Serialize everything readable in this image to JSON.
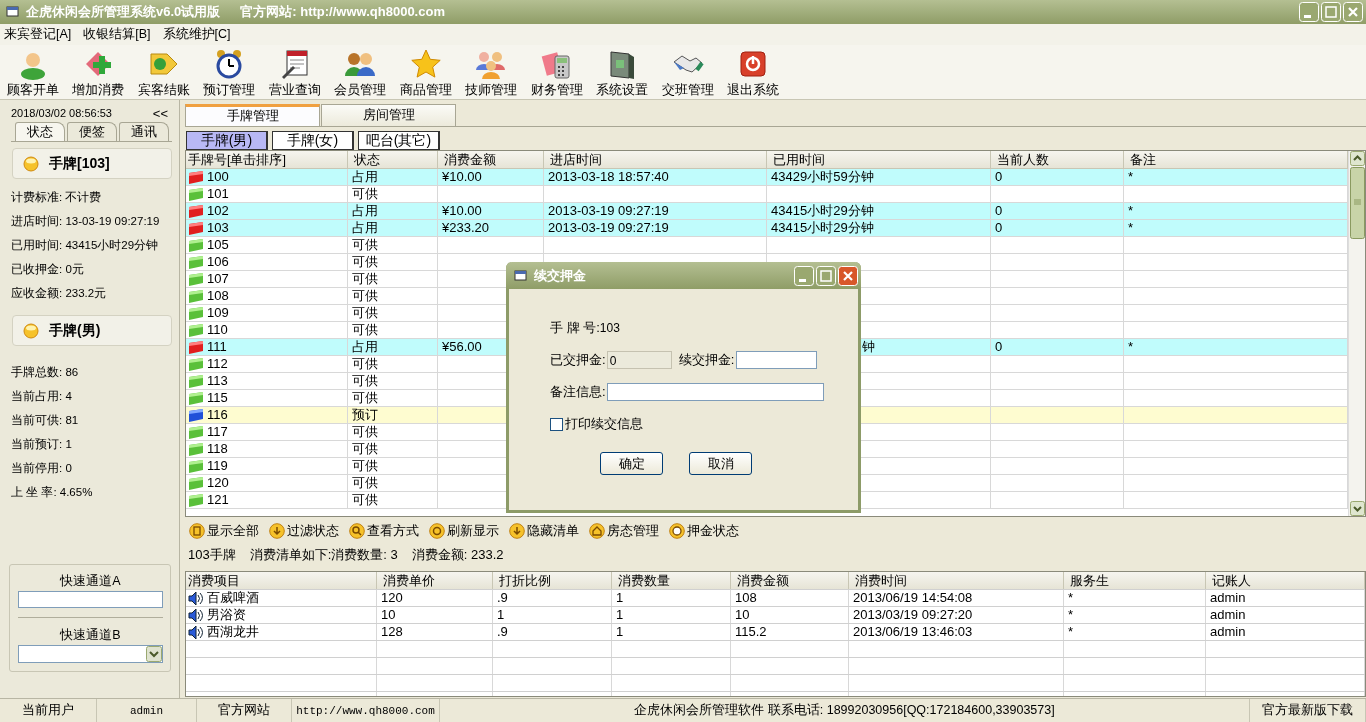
{
  "window": {
    "title": "企虎休闲会所管理系统v6.0试用版",
    "site": "官方网站: http://www.qh8000.com"
  },
  "menu": [
    "来宾登记[A]",
    "收银结算[B]",
    "系统维护[C]"
  ],
  "toolbar": [
    "顾客开单",
    "增加消费",
    "宾客结账",
    "预订管理",
    "营业查询",
    "会员管理",
    "商品管理",
    "技师管理",
    "财务管理",
    "系统设置",
    "交班管理",
    "退出系统"
  ],
  "sidebar": {
    "datetime": "2018/03/02 08:56:53",
    "collapse": "<<",
    "tabs": [
      {
        "label": "状态",
        "selected": true
      },
      {
        "label": "便签",
        "selected": false
      },
      {
        "label": "通讯",
        "selected": false
      }
    ],
    "sections": [
      {
        "title": "手牌[103]",
        "lines": [
          "计费标准: 不计费",
          "进店时间: 13-03-19 09:27:19",
          "已用时间: 43415小时29分钟",
          "已收押金: 0元",
          "应收金额: 233.2元"
        ]
      },
      {
        "title": "手牌(男)",
        "lines": [
          "手牌总数: 86",
          "当前占用: 4",
          "当前可供: 81",
          "当前预订: 1",
          "当前停用: 0",
          "上 坐 率: 4.65%"
        ]
      }
    ],
    "quick_a": {
      "label": "快速通道A"
    },
    "quick_b": {
      "label": "快速通道B"
    }
  },
  "tabs": [
    {
      "label": "手牌管理",
      "selected": true
    },
    {
      "label": "房间管理",
      "selected": false
    }
  ],
  "subtabs": [
    {
      "label": "手牌(男)",
      "selected": true
    },
    {
      "label": "手牌(女)",
      "selected": false
    },
    {
      "label": "吧台(其它)",
      "selected": false
    }
  ],
  "table": {
    "columns": [
      "手牌号[单击排序]",
      "状态",
      "消费金额",
      "进店时间",
      "已用时间",
      "当前人数",
      "备注"
    ],
    "rows": [
      {
        "no": "100",
        "kind": "occupied",
        "status": "占用",
        "amount": "¥10.00",
        "entered": "2013-03-18 18:57:40",
        "elapsed": "43429小时59分钟",
        "people": "0",
        "note": "*"
      },
      {
        "no": "101",
        "kind": "available",
        "status": "可供"
      },
      {
        "no": "102",
        "kind": "occupied",
        "status": "占用",
        "amount": "¥10.00",
        "entered": "2013-03-19 09:27:19",
        "elapsed": "43415小时29分钟",
        "people": "0",
        "note": "*"
      },
      {
        "no": "103",
        "kind": "occupied",
        "status": "占用",
        "amount": "¥233.20",
        "entered": "2013-03-19 09:27:19",
        "elapsed": "43415小时29分钟",
        "people": "0",
        "note": "*"
      },
      {
        "no": "105",
        "kind": "available",
        "status": "可供"
      },
      {
        "no": "106",
        "kind": "available",
        "status": "可供"
      },
      {
        "no": "107",
        "kind": "available",
        "status": "可供"
      },
      {
        "no": "108",
        "kind": "available",
        "status": "可供"
      },
      {
        "no": "109",
        "kind": "available",
        "status": "可供"
      },
      {
        "no": "110",
        "kind": "available",
        "status": "可供"
      },
      {
        "no": "111",
        "kind": "occupied",
        "status": "占用",
        "amount": "¥56.00",
        "elapsed": "钟",
        "covered": true,
        "people": "0",
        "note": "*"
      },
      {
        "no": "112",
        "kind": "available",
        "status": "可供"
      },
      {
        "no": "113",
        "kind": "available",
        "status": "可供"
      },
      {
        "no": "115",
        "kind": "available",
        "status": "可供"
      },
      {
        "no": "116",
        "kind": "reserved",
        "status": "预订"
      },
      {
        "no": "117",
        "kind": "available",
        "status": "可供"
      },
      {
        "no": "118",
        "kind": "available",
        "status": "可供"
      },
      {
        "no": "119",
        "kind": "available",
        "status": "可供"
      },
      {
        "no": "120",
        "kind": "available",
        "status": "可供"
      },
      {
        "no": "121",
        "kind": "available",
        "status": "可供"
      }
    ]
  },
  "actions": [
    "显示全部",
    "过滤状态",
    "查看方式",
    "刷新显示",
    "隐藏清单",
    "房态管理",
    "押金状态"
  ],
  "summary": {
    "card": "103手牌",
    "list": "消费清单如下:消费数量: 3",
    "total": "消费金额: 233.2"
  },
  "bill": {
    "columns": [
      "消费项目",
      "消费单价",
      "打折比例",
      "消费数量",
      "消费金额",
      "消费时间",
      "服务生",
      "记账人"
    ],
    "rows": [
      [
        "百威啤酒",
        "120",
        ".9",
        "1",
        "108",
        "2013/06/19 14:54:08",
        "*",
        "admin"
      ],
      [
        "男浴资",
        "10",
        "1",
        "1",
        "10",
        "2013/03/19 09:27:20",
        "*",
        "admin"
      ],
      [
        "西湖龙井",
        "128",
        ".9",
        "1",
        "115.2",
        "2013/06/19 13:46:03",
        "*",
        "admin"
      ]
    ]
  },
  "status_bar": [
    "当前用户",
    "admin",
    "官方网站",
    "http://www.qh8000.com",
    "企虎休闲会所管理软件  联系电话: 18992030956[QQ:172184600,33903573]",
    "官方最新版下载"
  ],
  "dialog": {
    "title": "续交押金",
    "card_label": "手 牌 号:",
    "card_value": "103",
    "paid_label": "已交押金:",
    "paid_value": "0",
    "paid_disabled": true,
    "more_label": "续交押金:",
    "note_label": "备注信息:",
    "print": {
      "label": "打印续交信息",
      "checked": false
    },
    "buttons": [
      "确定",
      "取消"
    ]
  }
}
